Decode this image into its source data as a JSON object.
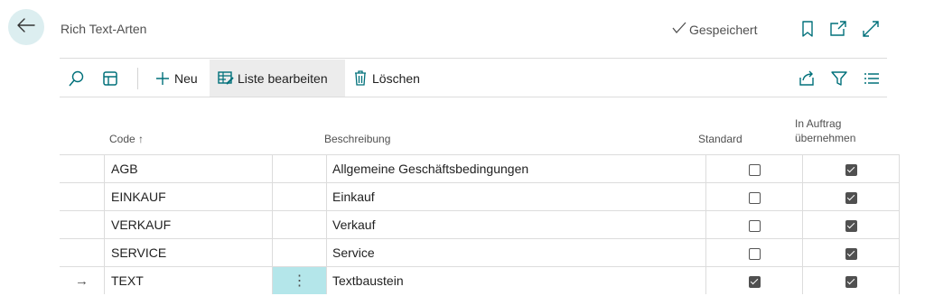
{
  "header": {
    "title": "Rich Text-Arten",
    "saved_status": "Gespeichert"
  },
  "toolbar": {
    "new_label": "Neu",
    "edit_list_label": "Liste bearbeiten",
    "delete_label": "Löschen"
  },
  "columns": {
    "code": "Code",
    "sort_indicator": "↑",
    "description": "Beschreibung",
    "standard": "Standard",
    "in_order_line1": "In Auftrag",
    "in_order_line2": "übernehmen"
  },
  "rows": [
    {
      "code": "AGB",
      "description": "Allgemeine Geschäftsbedingungen",
      "standard": false,
      "in_order": true,
      "selected": false
    },
    {
      "code": "EINKAUF",
      "description": "Einkauf",
      "standard": false,
      "in_order": true,
      "selected": false
    },
    {
      "code": "VERKAUF",
      "description": "Verkauf",
      "standard": false,
      "in_order": true,
      "selected": false
    },
    {
      "code": "SERVICE",
      "description": "Service",
      "standard": false,
      "in_order": true,
      "selected": false
    },
    {
      "code": "TEXT",
      "description": "Textbaustein",
      "standard": true,
      "in_order": true,
      "selected": true
    }
  ],
  "icons": {
    "selected_row_marker": "→",
    "row_menu": "⋮"
  },
  "colors": {
    "accent": "#00707a",
    "selected_cell": "#b4e6ea",
    "back_button_bg": "#dceef0"
  }
}
